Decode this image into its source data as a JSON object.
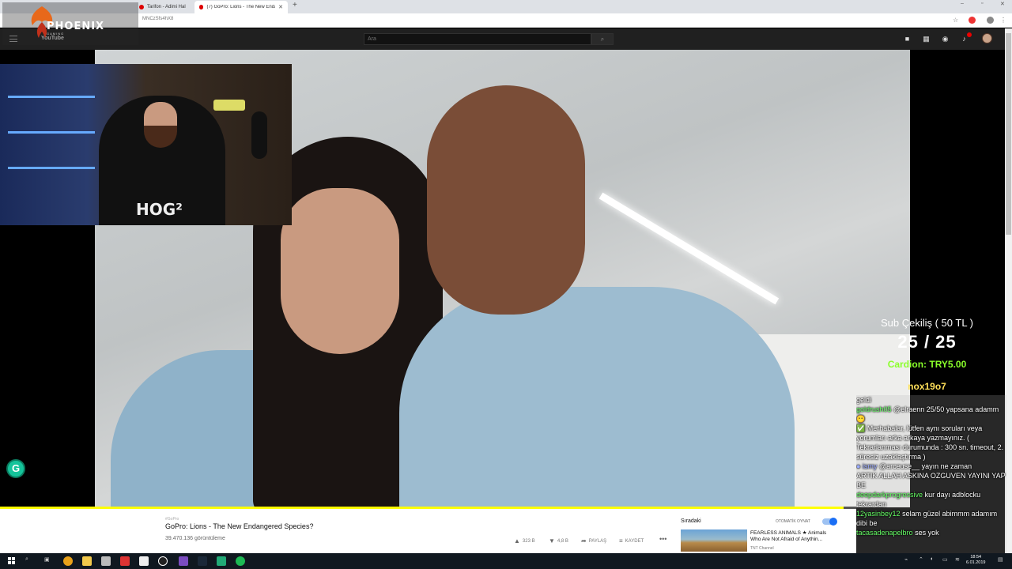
{
  "browser": {
    "tabs": [
      {
        "label": "Tarifon - Adimi Hal",
        "active": false
      },
      {
        "label": "(7) GoPro: Lions - The New Endan",
        "active": true
      }
    ],
    "new_tab": "+",
    "address": "MNCzSfs4hX8",
    "window_controls": [
      "–",
      "▫",
      "✕"
    ]
  },
  "overlay_logo": {
    "name": "PHOENIX",
    "tagline": "GAMING"
  },
  "youtube": {
    "logo": "YouTube",
    "search_placeholder": "Ara",
    "search_button": "⌕",
    "notification_color": "#e00000"
  },
  "webcam": {
    "shirt_logo": "HOG²"
  },
  "stream_overlay": {
    "giveaway_title": "Sub Çekiliş ( 50 TL )",
    "giveaway_count": "25 / 25",
    "donation_text": "Cardion: TRY5.00",
    "donor_name": "nox19o7",
    "chat": [
      {
        "user": "",
        "message": "geldi"
      },
      {
        "user": "goldrush05",
        "message": "@elraenn 25/50 yapsana adamm 😶"
      },
      {
        "user": "✅",
        "message": "Merhabalar, lütfen aynı soruları veya yorumları arka arkaya yazmayınız. ( Tekrarlanması durumunda : 300 sn. timeout, 2. süresiz uzaklaştırma )"
      },
      {
        "user": "● ismy",
        "message": "@arceuse__ yayın ne zaman"
      },
      {
        "user": "",
        "message": "ARTIK ALLAH ASKINA OZGUVEN YAYINI YAP BE"
      },
      {
        "user": "deepdarkprogressive",
        "message": "kur dayı adblocku"
      },
      {
        "user": "tekrardan",
        "message": ""
      },
      {
        "user": "12yasinbey12",
        "message": "selam güzel abimmm adamım dibi be"
      },
      {
        "user": "tacasadenapelbro",
        "message": "ses yok"
      }
    ]
  },
  "player": {
    "progress": 0.985,
    "progress_color": "#ffff00"
  },
  "video_info": {
    "channel": "#GoPro",
    "title": "GoPro: Lions - The New Endangered Species?",
    "views": "39.470.136 görüntüleme",
    "likes": "323 B",
    "dislikes": "4,8 B",
    "share": "PAYLAŞ",
    "save": "KAYDET",
    "more": "•••"
  },
  "up_next": {
    "heading": "Sıradaki",
    "autoplay_label": "OTOMATİK OYNAT",
    "autoplay_on": true,
    "video": {
      "title": "FEARLESS ANIMALS ★ Animals Who Are Not Afraid of Anythin...",
      "channel": "TNT Channel"
    }
  },
  "taskbar": {
    "time": "18:54",
    "date": "6.01.2019"
  },
  "colors": {
    "accent_youtube": "#202020",
    "donation": "#8aff2a",
    "donor": "#ffe05a",
    "autoplay": "#1a6ef5"
  }
}
